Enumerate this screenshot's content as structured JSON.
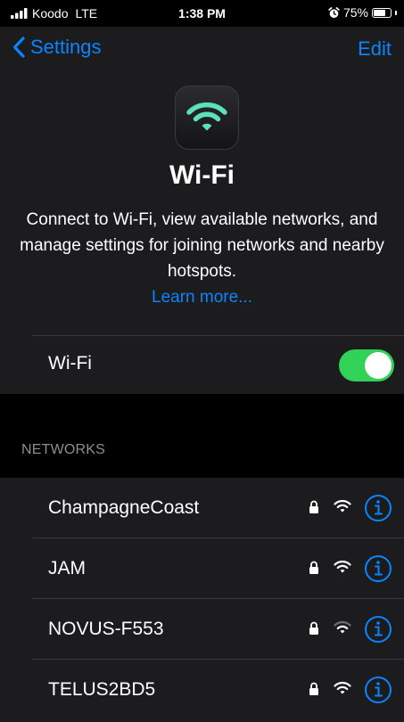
{
  "status_bar": {
    "carrier": "Koodo",
    "network": "LTE",
    "time": "1:38 PM",
    "battery": "75%",
    "battery_level": 0.75
  },
  "nav": {
    "back_label": "Settings",
    "edit_label": "Edit"
  },
  "header": {
    "title": "Wi-Fi",
    "description": "Connect to Wi-Fi, view available networks, and manage settings for joining networks and nearby hotspots.",
    "learn_more": "Learn more..."
  },
  "wifi_toggle": {
    "label": "Wi-Fi",
    "on": true
  },
  "networks": {
    "header": "NETWORKS",
    "items": [
      {
        "name": "ChampagneCoast",
        "secured": true,
        "signal": 3
      },
      {
        "name": "JAM",
        "secured": true,
        "signal": 3
      },
      {
        "name": "NOVUS-F553",
        "secured": true,
        "signal": 2
      },
      {
        "name": "TELUS2BD5",
        "secured": true,
        "signal": 3
      }
    ]
  },
  "colors": {
    "accent": "#0a84ff",
    "toggle_on": "#32d158",
    "wifi_icon": "#5ce1b6",
    "cell_bg": "#1c1c1e"
  },
  "icons": {
    "back": "chevron-left-icon",
    "app": "wifi-icon",
    "lock": "lock-icon",
    "signal": "wifi-signal-icon",
    "info": "info-icon",
    "alarm": "alarm-icon",
    "cellular": "cellular-signal-icon"
  }
}
